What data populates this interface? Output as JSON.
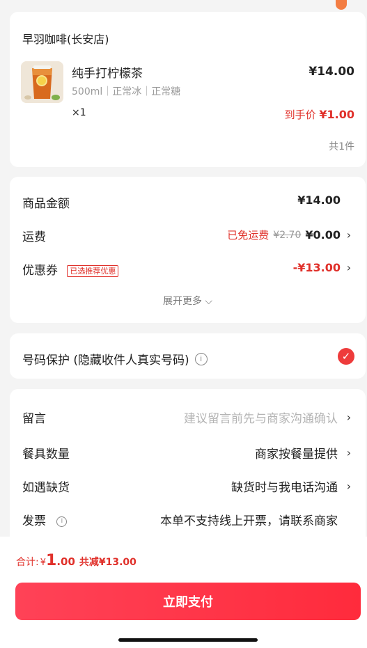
{
  "shop": {
    "name": "早羽咖啡(长安店)",
    "product": {
      "name": "纯手打柠檬茶",
      "spec": "500ml｜正常冰｜正常糖",
      "qty": "×1",
      "price": "¥14.00",
      "final_label": "到手价",
      "final_price": "¥1.00"
    },
    "total_count": "共1件"
  },
  "fees": {
    "goods_amount_label": "商品金额",
    "goods_amount": "¥14.00",
    "shipping_label": "运费",
    "shipping_free": "已免运费",
    "shipping_original": "¥2.70",
    "shipping_value": "¥0.00",
    "coupon_label": "优惠券",
    "coupon_badge": "已选推荐优惠",
    "coupon_value": "-¥13.00",
    "expand_more": "展开更多"
  },
  "protect": {
    "label": "号码保护 (隐藏收件人真实号码)",
    "checked": true
  },
  "extra": {
    "remark_label": "留言",
    "remark_placeholder": "建议留言前先与商家沟通确认",
    "tableware_label": "餐具数量",
    "tableware_value": "商家按餐量提供",
    "shortage_label": "如遇缺货",
    "shortage_value": "缺货时与我电话沟通",
    "invoice_label": "发票",
    "invoice_value": "本单不支持线上开票，请联系商家"
  },
  "summary": {
    "total_label": "合计:",
    "currency": "¥",
    "total_int": "1",
    "total_dec": ".00",
    "discount": "共减¥13.00"
  },
  "pay_button": "立即支付",
  "colors": {
    "accent_red": "#e0302a",
    "pay_button": "#ff2b3c",
    "background": "#f4f4f4"
  }
}
